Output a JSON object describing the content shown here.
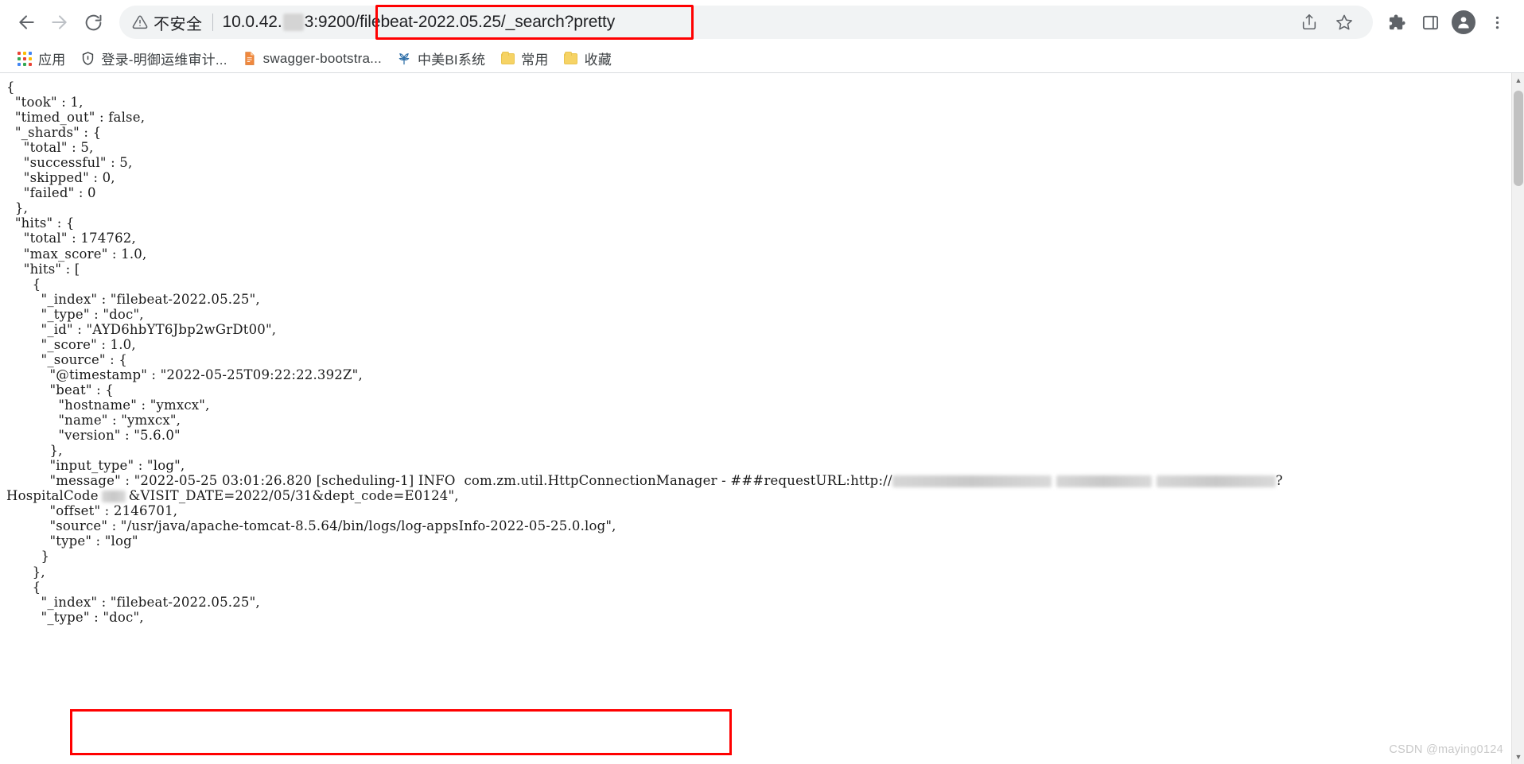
{
  "browser": {
    "nav": {
      "back_label": "Back",
      "forward_label": "Forward",
      "reload_label": "Reload"
    },
    "omnibox": {
      "security_warning": "不安全",
      "url_host": "10.0.42.",
      "url_host_tail": "3:9200",
      "url_separator": "/",
      "url_path": "filebeat-2022.05.25/_search?pretty",
      "share_label": "Share",
      "bookmark_label": "Bookmark this tab",
      "extensions_label": "Extensions",
      "sidepanel_label": "Side panel",
      "profile_label": "Profile",
      "menu_label": "Customize and control Google Chrome"
    },
    "bookmarks": [
      {
        "label": "应用",
        "icon": "apps-grid-icon"
      },
      {
        "label": "登录-明御运维审计...",
        "icon": "shield-icon"
      },
      {
        "label": "swagger-bootstra...",
        "icon": "document-icon"
      },
      {
        "label": "中美BI系统",
        "icon": "plant-icon"
      },
      {
        "label": "常用",
        "icon": "folder-icon"
      },
      {
        "label": "收藏",
        "icon": "folder-icon"
      }
    ]
  },
  "highlights": {
    "url_box_color": "#ff0000",
    "source_box_color": "#ff0000"
  },
  "response": {
    "line_01": "{",
    "line_02": "  \"took\" : 1,",
    "line_03": "  \"timed_out\" : false,",
    "line_04": "  \"_shards\" : {",
    "line_05": "    \"total\" : 5,",
    "line_06": "    \"successful\" : 5,",
    "line_07": "    \"skipped\" : 0,",
    "line_08": "    \"failed\" : 0",
    "line_09": "  },",
    "line_10": "  \"hits\" : {",
    "line_11": "    \"total\" : 174762,",
    "line_12": "    \"max_score\" : 1.0,",
    "line_13": "    \"hits\" : [",
    "line_14": "      {",
    "line_15": "        \"_index\" : \"filebeat-2022.05.25\",",
    "line_16": "        \"_type\" : \"doc\",",
    "line_17": "        \"_id\" : \"AYD6hbYT6Jbp2wGrDt00\",",
    "line_18": "        \"_score\" : 1.0,",
    "line_19": "        \"_source\" : {",
    "line_20": "          \"@timestamp\" : \"2022-05-25T09:22:22.392Z\",",
    "line_21": "          \"beat\" : {",
    "line_22": "            \"hostname\" : \"ymxcx\",",
    "line_23": "            \"name\" : \"ymxcx\",",
    "line_24": "            \"version\" : \"5.6.0\"",
    "line_25": "          },",
    "line_26": "          \"input_type\" : \"log\",",
    "line_27_a": "          \"message\" : \"2022-05-25 03:01:26.820 [scheduling-1] INFO  com.zm.util.HttpConnectionManager - ###requestURL:http://",
    "line_27_b": "?",
    "line_27_c": "HospitalCode",
    "line_27_d": "&VISIT_DATE=2022/05/31&dept_code=E0124\",",
    "line_28": "          \"offset\" : 2146701,",
    "line_29": "          \"source\" : \"/usr/java/apache-tomcat-8.5.64/bin/logs/log-appsInfo-2022-05-25.0.log\",",
    "line_30": "          \"type\" : \"log\"",
    "line_31": "        }",
    "line_32": "      },",
    "line_33": "      {",
    "line_34": "        \"_index\" : \"filebeat-2022.05.25\",",
    "line_35": "        \"_type\" : \"doc\","
  },
  "watermark": "CSDN @maying0124"
}
